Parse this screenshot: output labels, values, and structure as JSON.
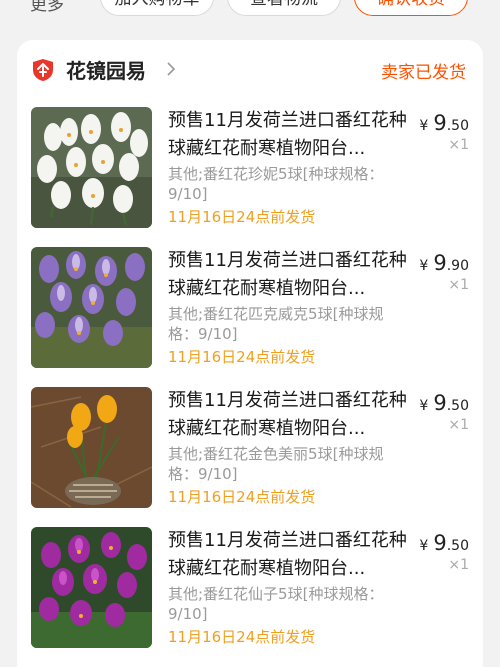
{
  "top_actions": {
    "more": "更多",
    "btn1": "加入购物车",
    "btn2": "查看物流",
    "btn3": "确认收货"
  },
  "shop": {
    "name": "花镜园易",
    "status": "卖家已发货",
    "logo_icon": "shop-logo-icon",
    "accent": "#ff5000"
  },
  "items": [
    {
      "title": "预售11月发荷兰进口番红花种球藏红花耐寒植物阳台...",
      "spec": "其他;番红花珍妮5球[种球规格：9/10]",
      "ship": "11月16日24点前发货",
      "currency": "¥",
      "price_int": "9",
      "price_dec": ".50",
      "qty": "×1"
    },
    {
      "title": "预售11月发荷兰进口番红花种球藏红花耐寒植物阳台...",
      "spec": "其他;番红花匹克威克5球[种球规格：9/10]",
      "ship": "11月16日24点前发货",
      "currency": "¥",
      "price_int": "9",
      "price_dec": ".90",
      "qty": "×1"
    },
    {
      "title": "预售11月发荷兰进口番红花种球藏红花耐寒植物阳台...",
      "spec": "其他;番红花金色美丽5球[种球规格：9/10]",
      "ship": "11月16日24点前发货",
      "currency": "¥",
      "price_int": "9",
      "price_dec": ".50",
      "qty": "×1"
    },
    {
      "title": "预售11月发荷兰进口番红花种球藏红花耐寒植物阳台...",
      "spec": "其他;番红花仙子5球[种球规格：9/10]",
      "ship": "11月16日24点前发货",
      "currency": "¥",
      "price_int": "9",
      "price_dec": ".50",
      "qty": "×1"
    }
  ]
}
